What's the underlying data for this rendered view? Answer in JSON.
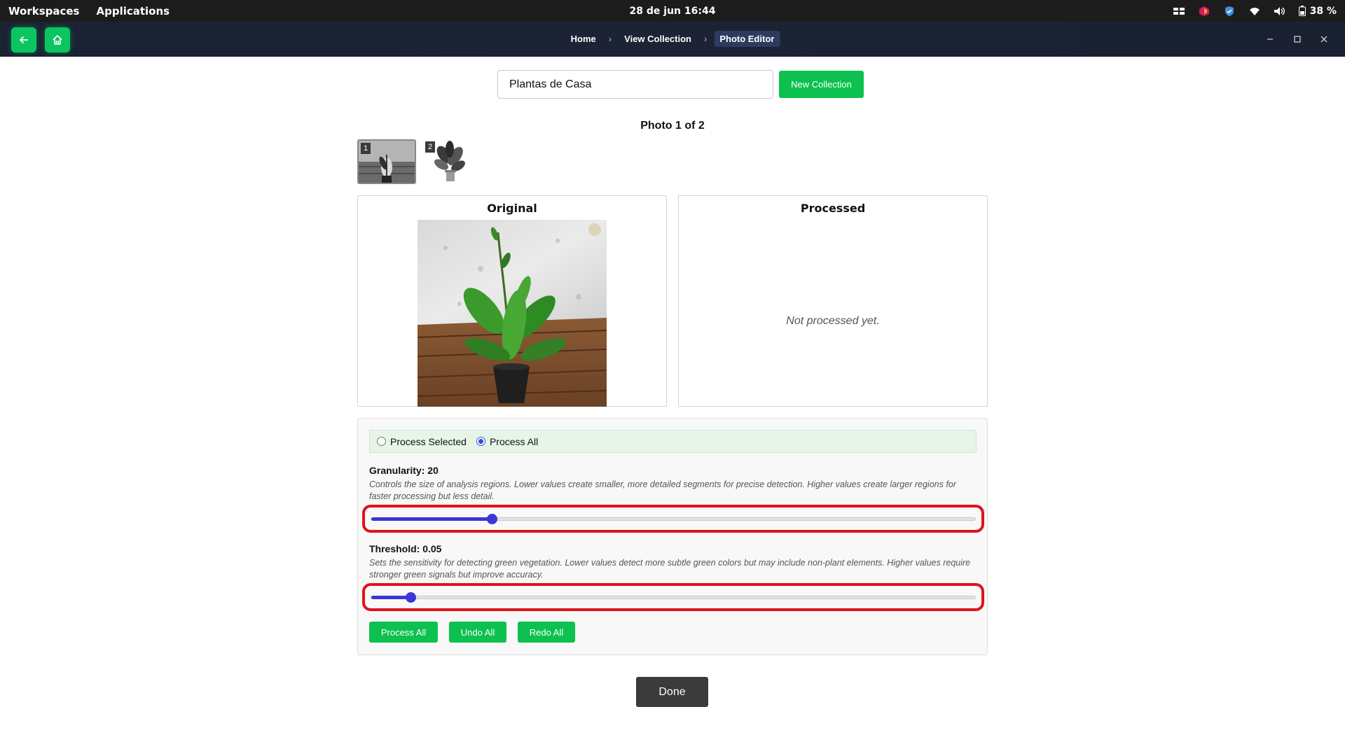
{
  "system": {
    "workspaces": "Workspaces",
    "applications": "Applications",
    "clock": "28 de jun  16:44",
    "battery": "38 %"
  },
  "header": {
    "breadcrumbs": [
      "Home",
      "View Collection",
      "Photo Editor"
    ],
    "active_crumb": "Photo Editor"
  },
  "collection": {
    "name_value": "Plantas de Casa",
    "new_button": "New Collection"
  },
  "photos": {
    "counter": "Photo 1 of 2",
    "thumbnails": [
      {
        "number": "1",
        "selected": true
      },
      {
        "number": "2",
        "selected": false
      }
    ]
  },
  "panels": {
    "original_title": "Original",
    "processed_title": "Processed",
    "processed_empty": "Not processed yet."
  },
  "settings": {
    "mode_options": [
      "Process Selected",
      "Process All"
    ],
    "mode_selected": "Process All",
    "granularity": {
      "label": "Granularity: 20",
      "value": 20,
      "slider_fraction": 0.2,
      "description": "Controls the size of analysis regions. Lower values create smaller, more detailed segments for precise detection. Higher values create larger regions for faster processing but less detail."
    },
    "threshold": {
      "label": "Threshold: 0.05",
      "value": 0.05,
      "slider_fraction": 0.065,
      "description": "Sets the sensitivity for detecting green vegetation. Lower values detect more subtle green colors but may include non-plant elements. Higher values require stronger green signals but improve accuracy."
    },
    "buttons": [
      "Process All",
      "Undo All",
      "Redo All"
    ]
  },
  "done_button": "Done",
  "colors": {
    "accent_green": "#0cc14f",
    "slider_blue": "#3b36d8",
    "highlight_red": "#e0121a"
  }
}
